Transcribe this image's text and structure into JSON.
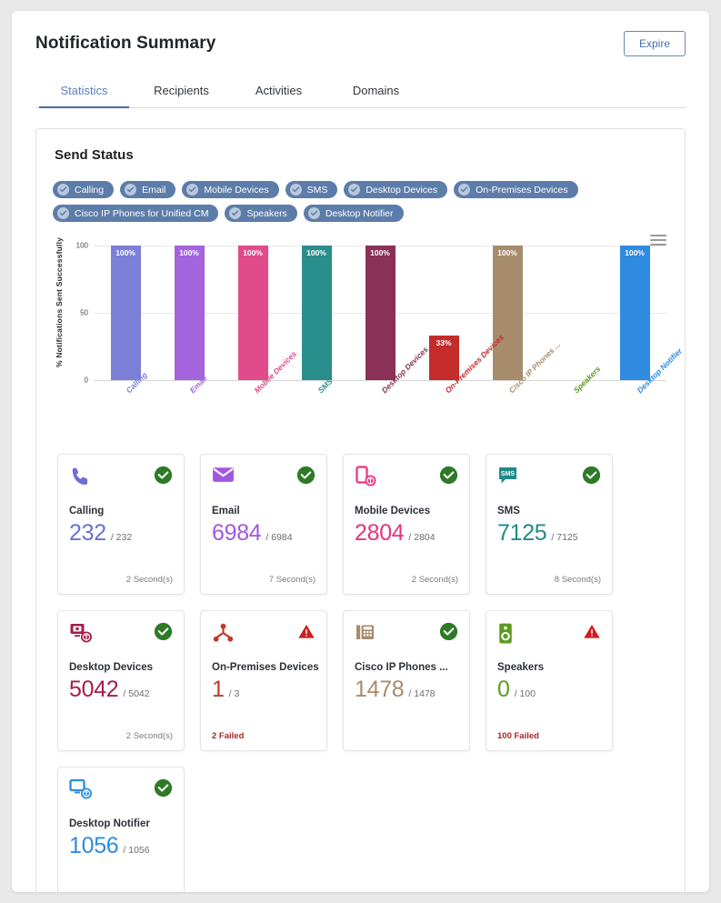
{
  "header": {
    "title": "Notification Summary",
    "expire_label": "Expire"
  },
  "tabs": [
    {
      "label": "Statistics",
      "active": true
    },
    {
      "label": "Recipients",
      "active": false
    },
    {
      "label": "Activities",
      "active": false
    },
    {
      "label": "Domains",
      "active": false
    }
  ],
  "section": {
    "title": "Send Status"
  },
  "legend": [
    {
      "label": "Calling",
      "icon": "check-circle-icon"
    },
    {
      "label": "Email",
      "icon": "check-circle-icon"
    },
    {
      "label": "Mobile Devices",
      "icon": "check-circle-icon"
    },
    {
      "label": "SMS",
      "icon": "check-circle-icon"
    },
    {
      "label": "Desktop Devices",
      "icon": "check-circle-icon"
    },
    {
      "label": "On-Premises Devices",
      "icon": "check-circle-icon"
    },
    {
      "label": "Cisco IP Phones for Unified CM",
      "icon": "check-circle-icon"
    },
    {
      "label": "Speakers",
      "icon": "check-circle-icon"
    },
    {
      "label": "Desktop Notifier",
      "icon": "check-circle-icon"
    }
  ],
  "chart_menu_icon": "hamburger-menu-icon",
  "chart_data": {
    "type": "bar",
    "title": "",
    "xlabel": "",
    "ylabel": "% Notifications Sent Successfully",
    "ylim": [
      0,
      100
    ],
    "yticks": [
      0,
      50,
      100
    ],
    "grid": true,
    "legend_position": "top",
    "categories": [
      "Calling",
      "Email",
      "Mobile Devices",
      "SMS",
      "Desktop Devices",
      "On-Premises Devices",
      "Cisco IP Phones ...",
      "Speakers",
      "Desktop Notifier"
    ],
    "values": [
      100,
      100,
      100,
      100,
      100,
      33,
      100,
      0,
      100
    ],
    "data_labels": [
      "100%",
      "100%",
      "100%",
      "100%",
      "100%",
      "33%",
      "100%",
      "",
      "100%"
    ],
    "colors": [
      "#7b7fd8",
      "#a364dd",
      "#e14b8a",
      "#2a8e8c",
      "#8b3157",
      "#c42b2b",
      "#a78c6b",
      "#5b9b1f",
      "#2f8be0"
    ]
  },
  "cards": [
    {
      "icon": "phone-handset-icon",
      "title": "Calling",
      "sent": "232",
      "total": "/ 232",
      "footer": "2 Second(s)",
      "failed": false,
      "status": "success-check-icon",
      "color": "#6b6fd4"
    },
    {
      "icon": "envelope-icon",
      "title": "Email",
      "sent": "6984",
      "total": "/ 6984",
      "footer": "7 Second(s)",
      "failed": false,
      "status": "success-check-icon",
      "color": "#a257e0"
    },
    {
      "icon": "mobile-phone-badge-icon",
      "title": "Mobile Devices",
      "sent": "2804",
      "total": "/ 2804",
      "footer": "2 Second(s)",
      "failed": false,
      "status": "success-check-icon",
      "color": "#e8337e"
    },
    {
      "icon": "sms-bubble-icon",
      "title": "SMS",
      "sent": "7125",
      "total": "/ 7125",
      "footer": "8 Second(s)",
      "failed": false,
      "status": "success-check-icon",
      "color": "#1f8b89"
    },
    {
      "icon": "desktop-device-badge-icon",
      "title": "Desktop Devices",
      "sent": "5042",
      "total": "/ 5042",
      "footer": "2 Second(s)",
      "failed": false,
      "status": "success-check-icon",
      "color": "#a51d4c"
    },
    {
      "icon": "network-nodes-icon",
      "title": "On-Premises Devices",
      "sent": "1",
      "total": "/ 3",
      "footer": "2 Failed",
      "failed": true,
      "status": "warning-triangle-icon",
      "color": "#c0392b"
    },
    {
      "icon": "desk-phone-icon",
      "title": "Cisco IP Phones ...",
      "sent": "1478",
      "total": "/ 1478",
      "footer": "",
      "failed": false,
      "status": "success-check-icon",
      "color": "#a78c6b"
    },
    {
      "icon": "speaker-icon",
      "title": "Speakers",
      "sent": "0",
      "total": "/ 100",
      "footer": "100 Failed",
      "failed": true,
      "status": "warning-triangle-icon",
      "color": "#5b9b1f"
    },
    {
      "icon": "monitor-badge-icon",
      "title": "Desktop Notifier",
      "sent": "1056",
      "total": "/ 1056",
      "footer": "",
      "failed": false,
      "status": "success-check-icon",
      "color": "#2f8be0"
    }
  ]
}
